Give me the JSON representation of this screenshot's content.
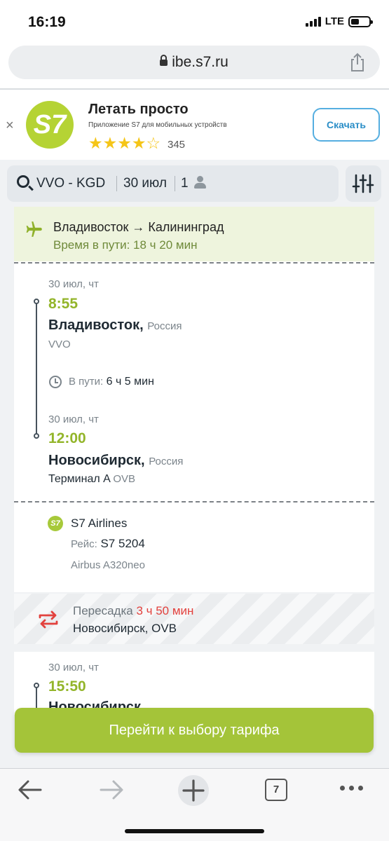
{
  "status": {
    "time": "16:19",
    "network": "LTE"
  },
  "browser": {
    "url": "ibe.s7.ru",
    "tab_count": "7"
  },
  "banner": {
    "close": "×",
    "logo_text": "S7",
    "title": "Летать просто",
    "subtitle": "Приложение S7 для мобильных устройств",
    "stars": "★★★★☆",
    "rating_value": 4,
    "rating_count": "345",
    "download_label": "Скачать"
  },
  "search": {
    "route": "VVO - KGD",
    "date": "30 июл",
    "passengers": "1"
  },
  "itinerary": {
    "title": "Владивосток → Калининград",
    "duration": "Время в пути: 18 ч 20 мин"
  },
  "segment1": {
    "dep_date": "30 июл, чт",
    "dep_time": "8:55",
    "dep_city": "Владивосток,",
    "dep_country": "Россия",
    "dep_code": "VVO",
    "transit_label": "В пути:",
    "transit_value": "6 ч 5 мин",
    "arr_date": "30 июл, чт",
    "arr_time": "12:00",
    "arr_city": "Новосибирск,",
    "arr_country": "Россия",
    "arr_terminal": "Терминал A",
    "arr_code": "OVB",
    "airline_logo": "S7",
    "airline": "S7 Airlines",
    "flight_label": "Рейс:",
    "flight_number": "S7 5204",
    "aircraft": "Airbus A320neo"
  },
  "transfer": {
    "label": "Пересадка",
    "duration": "3 ч 50 мин",
    "place": "Новосибирск, OVB"
  },
  "segment2": {
    "dep_date": "30 июл, чт",
    "dep_time": "15:50",
    "dep_city": "Новосибирск,"
  },
  "cta": {
    "label": "Перейти к выбору тарифа"
  },
  "colors": {
    "brand": "#a4c439",
    "accent_time": "#93b52a",
    "transfer_red": "#e2413d",
    "link": "#2a8ec7"
  }
}
